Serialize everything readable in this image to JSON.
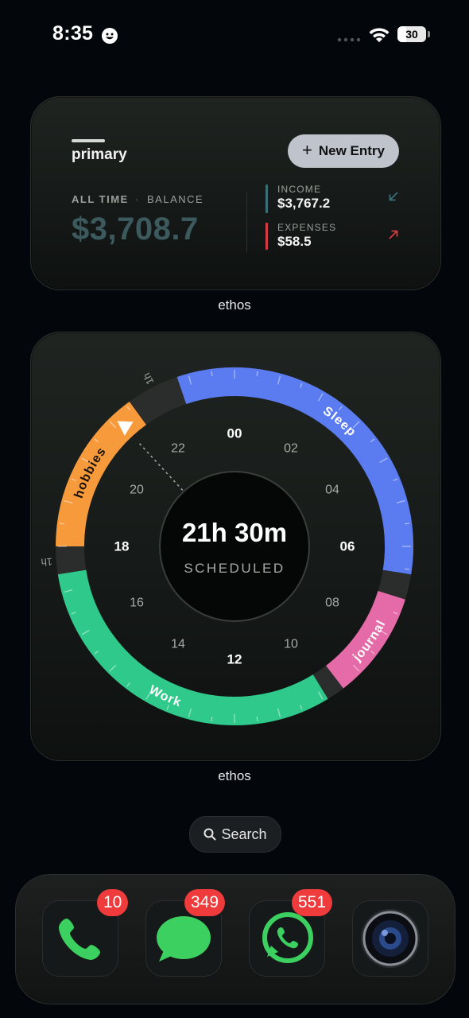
{
  "status_bar": {
    "time": "8:35",
    "battery": "30",
    "battery_fraction": 0.3
  },
  "finance_widget": {
    "title": "primary",
    "new_entry_label": "New Entry",
    "all_time_label": "ALL TIME",
    "separator": "·",
    "balance_label": "BALANCE",
    "balance_value": "$3,708.7",
    "income_label": "INCOME",
    "income_value": "$3,767.2",
    "expenses_label": "EXPENSES",
    "expenses_value": "$58.5",
    "app_label": "ethos",
    "colors": {
      "balance": "#3c5a5e",
      "income": "#3c6e78",
      "expense": "#d43b44"
    }
  },
  "schedule_widget": {
    "total": "21h 30m",
    "total_label": "SCHEDULED",
    "app_label": "ethos",
    "hour_labels": [
      {
        "h": 0,
        "text": "00",
        "major": true
      },
      {
        "h": 2,
        "text": "02",
        "major": false
      },
      {
        "h": 4,
        "text": "04",
        "major": false
      },
      {
        "h": 6,
        "text": "06",
        "major": true
      },
      {
        "h": 8,
        "text": "08",
        "major": false
      },
      {
        "h": 10,
        "text": "10",
        "major": false
      },
      {
        "h": 12,
        "text": "12",
        "major": true
      },
      {
        "h": 14,
        "text": "14",
        "major": false
      },
      {
        "h": 16,
        "text": "16",
        "major": false
      },
      {
        "h": 18,
        "text": "18",
        "major": true
      },
      {
        "h": 20,
        "text": "20",
        "major": false
      },
      {
        "h": 22,
        "text": "22",
        "major": false
      }
    ],
    "segments": [
      {
        "name": "Sleep",
        "start": 22.75,
        "end": 6.6,
        "color": "#5a7cf0"
      },
      {
        "name": "journal",
        "start": 7.15,
        "end": 9.5,
        "color": "#e56aa8"
      },
      {
        "name": "Work",
        "start": 9.9,
        "end": 17.4,
        "color": "#2ec98b"
      },
      {
        "name": "hobbies",
        "start": 18.0,
        "end": 21.6,
        "color": "#f79a3c"
      }
    ],
    "gap_labels": [
      {
        "h": 17.7,
        "text": "1h"
      },
      {
        "h": 22.2,
        "text": "1h"
      }
    ],
    "now_hour": 21.15
  },
  "search": {
    "label": "Search"
  },
  "dock": {
    "apps": [
      {
        "name": "phone",
        "badge": "10"
      },
      {
        "name": "messages",
        "badge": "349"
      },
      {
        "name": "whatsapp",
        "badge": "551"
      },
      {
        "name": "camera",
        "badge": ""
      }
    ]
  }
}
